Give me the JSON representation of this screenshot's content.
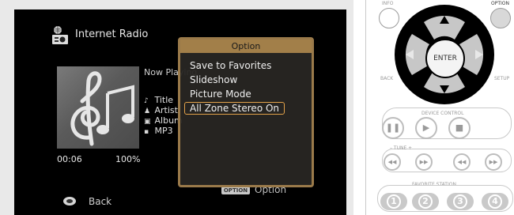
{
  "screen": {
    "source_title": "Internet Radio",
    "now_playing": "Now Playing",
    "meta": [
      {
        "icon": "note-icon",
        "glyph": "♪",
        "text": "Title"
      },
      {
        "icon": "artist-icon",
        "glyph": "♟",
        "text": "Artist"
      },
      {
        "icon": "album-icon",
        "glyph": "▣",
        "text": "Album"
      },
      {
        "icon": "format-icon",
        "glyph": "▪",
        "text": "MP3"
      }
    ],
    "time": "00:06",
    "volume": "100%",
    "back_label": "Back",
    "option_hint_button": "OPTION",
    "option_hint_label": "Option"
  },
  "option_menu": {
    "title": "Option",
    "items": [
      "Save to Favorites",
      "Slideshow",
      "Picture Mode",
      "All Zone Stereo On"
    ],
    "selected_index": 3
  },
  "remote": {
    "info_label": "INFO",
    "option_label": "OPTION",
    "back_label": "BACK",
    "setup_label": "SETUP",
    "enter_label": "ENTER",
    "device_control_label": "DEVICE CONTROL",
    "tune_label": "–   TUNE   +",
    "favorite_station_label": "FAVORITE STATION",
    "favorite_buttons": [
      "1",
      "2",
      "3",
      "4"
    ]
  },
  "colors": {
    "popup_border": "#9a7a4a",
    "popup_title": "#a27f49",
    "selection": "#e2a24a"
  }
}
